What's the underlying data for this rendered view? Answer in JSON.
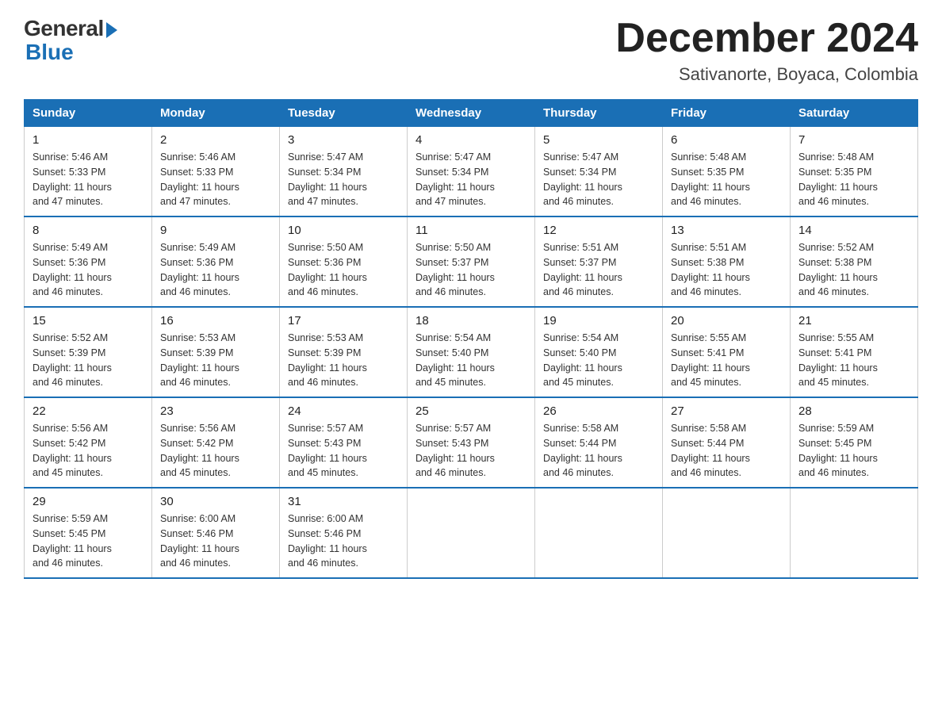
{
  "logo": {
    "general": "General",
    "blue": "Blue"
  },
  "title": "December 2024",
  "location": "Sativanorte, Boyaca, Colombia",
  "days_of_week": [
    "Sunday",
    "Monday",
    "Tuesday",
    "Wednesday",
    "Thursday",
    "Friday",
    "Saturday"
  ],
  "weeks": [
    [
      {
        "day": "1",
        "sunrise": "5:46 AM",
        "sunset": "5:33 PM",
        "daylight": "11 hours and 47 minutes."
      },
      {
        "day": "2",
        "sunrise": "5:46 AM",
        "sunset": "5:33 PM",
        "daylight": "11 hours and 47 minutes."
      },
      {
        "day": "3",
        "sunrise": "5:47 AM",
        "sunset": "5:34 PM",
        "daylight": "11 hours and 47 minutes."
      },
      {
        "day": "4",
        "sunrise": "5:47 AM",
        "sunset": "5:34 PM",
        "daylight": "11 hours and 47 minutes."
      },
      {
        "day": "5",
        "sunrise": "5:47 AM",
        "sunset": "5:34 PM",
        "daylight": "11 hours and 46 minutes."
      },
      {
        "day": "6",
        "sunrise": "5:48 AM",
        "sunset": "5:35 PM",
        "daylight": "11 hours and 46 minutes."
      },
      {
        "day": "7",
        "sunrise": "5:48 AM",
        "sunset": "5:35 PM",
        "daylight": "11 hours and 46 minutes."
      }
    ],
    [
      {
        "day": "8",
        "sunrise": "5:49 AM",
        "sunset": "5:36 PM",
        "daylight": "11 hours and 46 minutes."
      },
      {
        "day": "9",
        "sunrise": "5:49 AM",
        "sunset": "5:36 PM",
        "daylight": "11 hours and 46 minutes."
      },
      {
        "day": "10",
        "sunrise": "5:50 AM",
        "sunset": "5:36 PM",
        "daylight": "11 hours and 46 minutes."
      },
      {
        "day": "11",
        "sunrise": "5:50 AM",
        "sunset": "5:37 PM",
        "daylight": "11 hours and 46 minutes."
      },
      {
        "day": "12",
        "sunrise": "5:51 AM",
        "sunset": "5:37 PM",
        "daylight": "11 hours and 46 minutes."
      },
      {
        "day": "13",
        "sunrise": "5:51 AM",
        "sunset": "5:38 PM",
        "daylight": "11 hours and 46 minutes."
      },
      {
        "day": "14",
        "sunrise": "5:52 AM",
        "sunset": "5:38 PM",
        "daylight": "11 hours and 46 minutes."
      }
    ],
    [
      {
        "day": "15",
        "sunrise": "5:52 AM",
        "sunset": "5:39 PM",
        "daylight": "11 hours and 46 minutes."
      },
      {
        "day": "16",
        "sunrise": "5:53 AM",
        "sunset": "5:39 PM",
        "daylight": "11 hours and 46 minutes."
      },
      {
        "day": "17",
        "sunrise": "5:53 AM",
        "sunset": "5:39 PM",
        "daylight": "11 hours and 46 minutes."
      },
      {
        "day": "18",
        "sunrise": "5:54 AM",
        "sunset": "5:40 PM",
        "daylight": "11 hours and 45 minutes."
      },
      {
        "day": "19",
        "sunrise": "5:54 AM",
        "sunset": "5:40 PM",
        "daylight": "11 hours and 45 minutes."
      },
      {
        "day": "20",
        "sunrise": "5:55 AM",
        "sunset": "5:41 PM",
        "daylight": "11 hours and 45 minutes."
      },
      {
        "day": "21",
        "sunrise": "5:55 AM",
        "sunset": "5:41 PM",
        "daylight": "11 hours and 45 minutes."
      }
    ],
    [
      {
        "day": "22",
        "sunrise": "5:56 AM",
        "sunset": "5:42 PM",
        "daylight": "11 hours and 45 minutes."
      },
      {
        "day": "23",
        "sunrise": "5:56 AM",
        "sunset": "5:42 PM",
        "daylight": "11 hours and 45 minutes."
      },
      {
        "day": "24",
        "sunrise": "5:57 AM",
        "sunset": "5:43 PM",
        "daylight": "11 hours and 45 minutes."
      },
      {
        "day": "25",
        "sunrise": "5:57 AM",
        "sunset": "5:43 PM",
        "daylight": "11 hours and 46 minutes."
      },
      {
        "day": "26",
        "sunrise": "5:58 AM",
        "sunset": "5:44 PM",
        "daylight": "11 hours and 46 minutes."
      },
      {
        "day": "27",
        "sunrise": "5:58 AM",
        "sunset": "5:44 PM",
        "daylight": "11 hours and 46 minutes."
      },
      {
        "day": "28",
        "sunrise": "5:59 AM",
        "sunset": "5:45 PM",
        "daylight": "11 hours and 46 minutes."
      }
    ],
    [
      {
        "day": "29",
        "sunrise": "5:59 AM",
        "sunset": "5:45 PM",
        "daylight": "11 hours and 46 minutes."
      },
      {
        "day": "30",
        "sunrise": "6:00 AM",
        "sunset": "5:46 PM",
        "daylight": "11 hours and 46 minutes."
      },
      {
        "day": "31",
        "sunrise": "6:00 AM",
        "sunset": "5:46 PM",
        "daylight": "11 hours and 46 minutes."
      },
      null,
      null,
      null,
      null
    ]
  ],
  "labels": {
    "sunrise": "Sunrise:",
    "sunset": "Sunset:",
    "daylight": "Daylight:"
  }
}
